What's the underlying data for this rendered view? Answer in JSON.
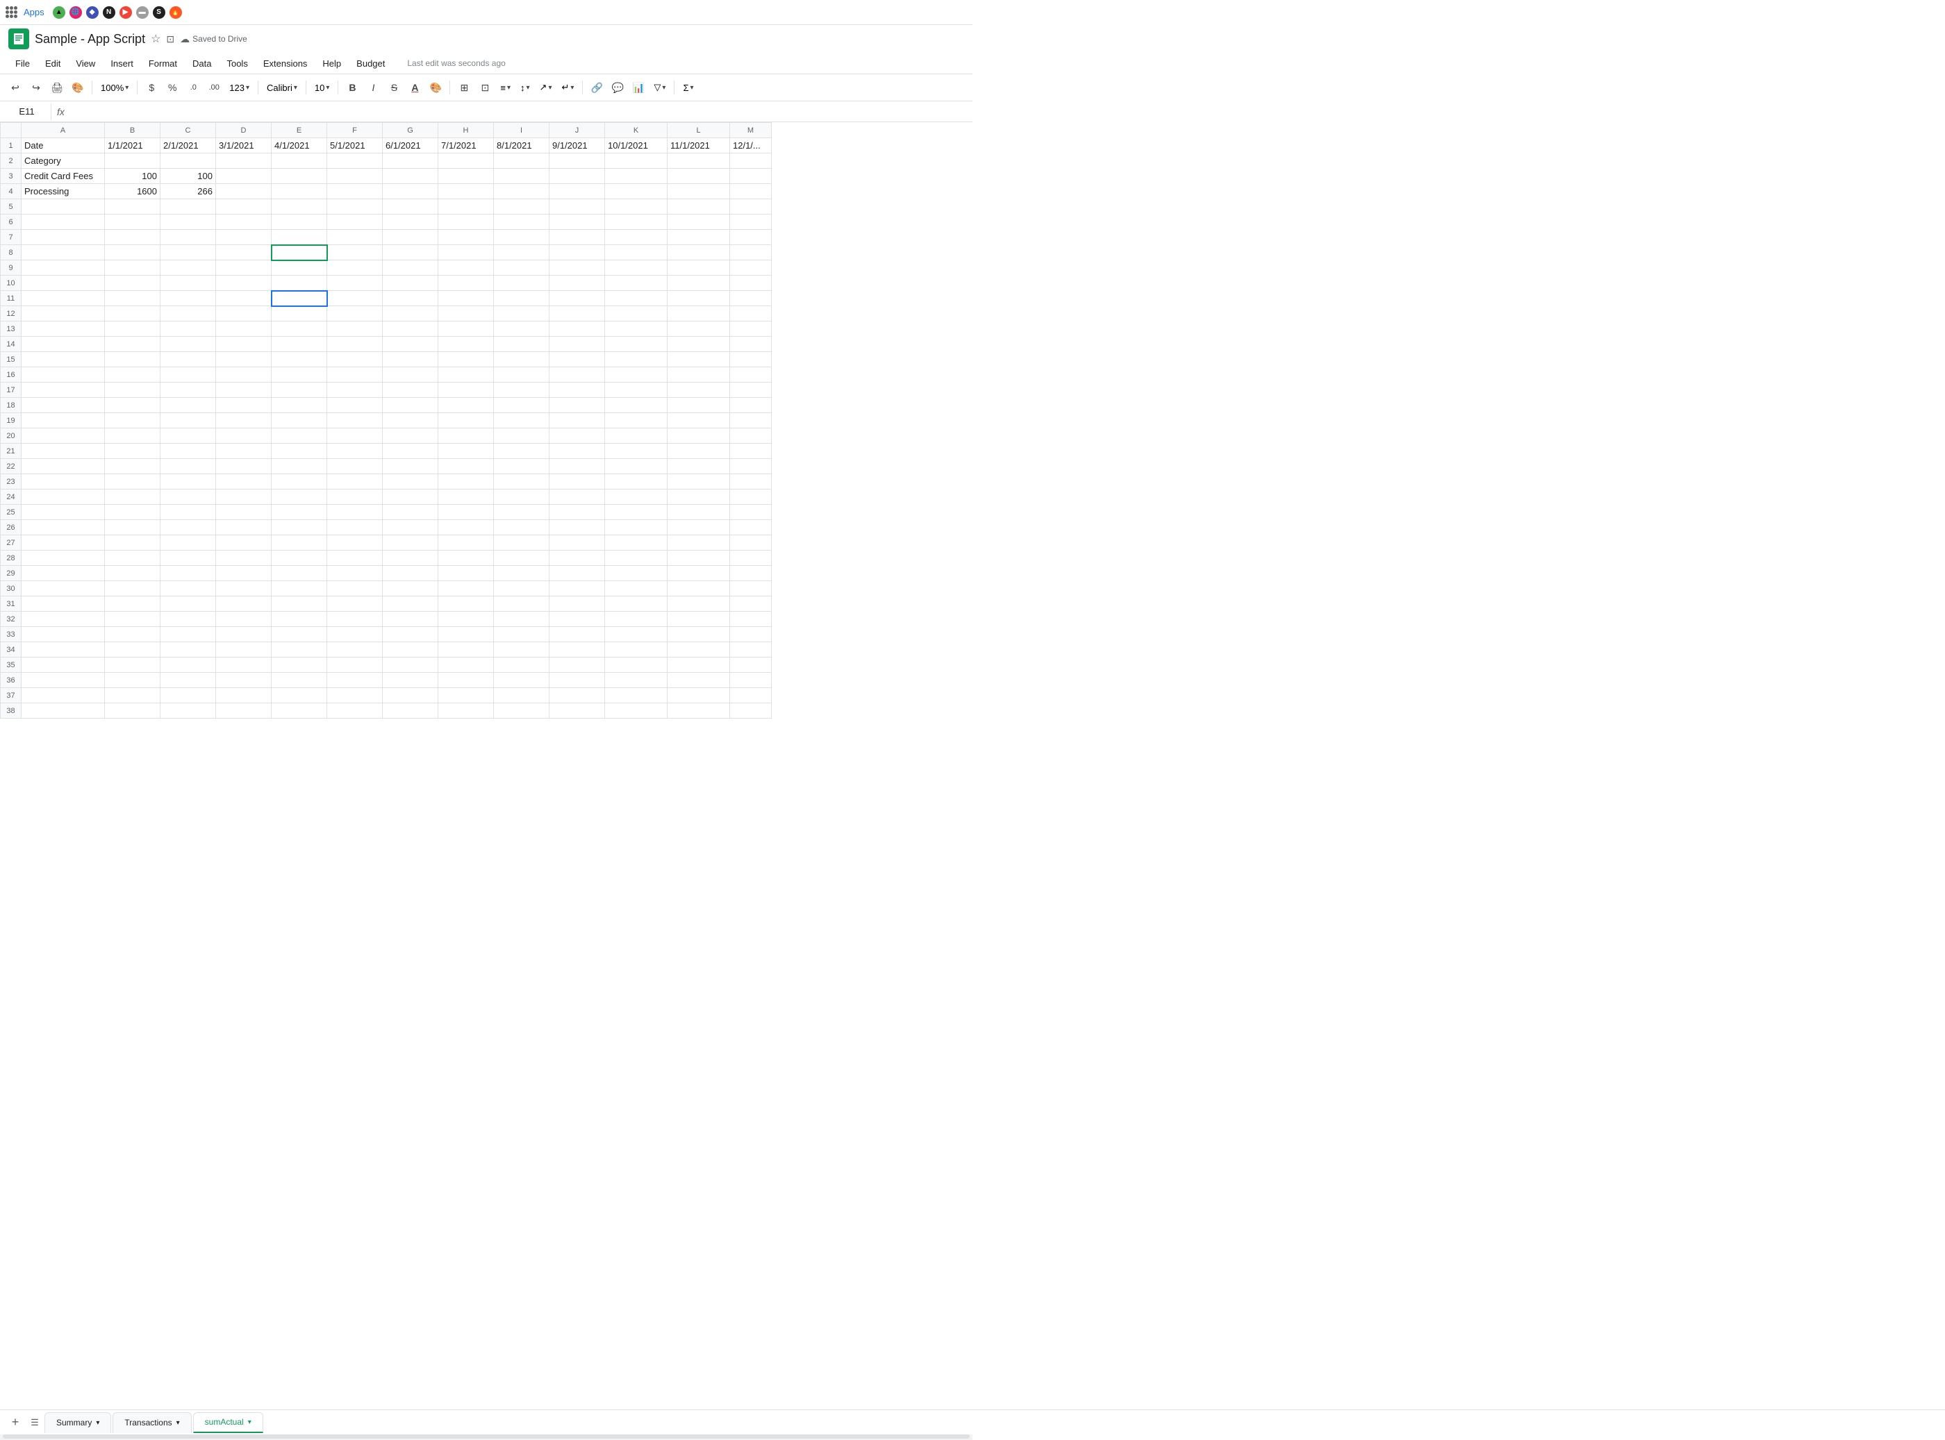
{
  "topbar": {
    "apps_label": "Apps"
  },
  "titlebar": {
    "doc_title": "Sample - App Script",
    "save_status": "Saved to Drive"
  },
  "menubar": {
    "items": [
      "File",
      "Edit",
      "View",
      "Insert",
      "Format",
      "Data",
      "Tools",
      "Extensions",
      "Help",
      "Budget"
    ],
    "last_edit": "Last edit was seconds ago"
  },
  "toolbar": {
    "zoom": "100%",
    "currency": "$",
    "percent": "%",
    "decimal0": ".0",
    "decimal2": ".00",
    "format123": "123",
    "font": "Calibri",
    "font_size": "10",
    "bold": "B",
    "italic": "I",
    "strikethrough": "S"
  },
  "formula_bar": {
    "cell_ref": "E11",
    "fx": "fx"
  },
  "columns": [
    "",
    "A",
    "B",
    "C",
    "D",
    "E",
    "F",
    "G",
    "H",
    "I",
    "J",
    "K",
    "L",
    "M"
  ],
  "rows": {
    "count": 38,
    "data": {
      "1": {
        "A": "Date",
        "B": "1/1/2021",
        "C": "2/1/2021",
        "D": "3/1/2021",
        "E": "4/1/2021",
        "F": "5/1/2021",
        "G": "6/1/2021",
        "H": "7/1/2021",
        "I": "8/1/2021",
        "J": "9/1/2021",
        "K": "10/1/2021",
        "L": "11/1/2021",
        "M": "12/1/..."
      },
      "2": {
        "A": "Category"
      },
      "3": {
        "A": "Credit Card Fees",
        "B": "100",
        "C": "100"
      },
      "4": {
        "A": "Processing",
        "B": "1600",
        "C": "266"
      }
    }
  },
  "special_cells": {
    "E8": {
      "style": "green-border"
    },
    "E11": {
      "style": "blue-border",
      "selected": true
    }
  },
  "sheet_tabs": [
    {
      "label": "Summary",
      "active": false
    },
    {
      "label": "Transactions",
      "active": false
    },
    {
      "label": "sumActual",
      "active": true
    }
  ]
}
